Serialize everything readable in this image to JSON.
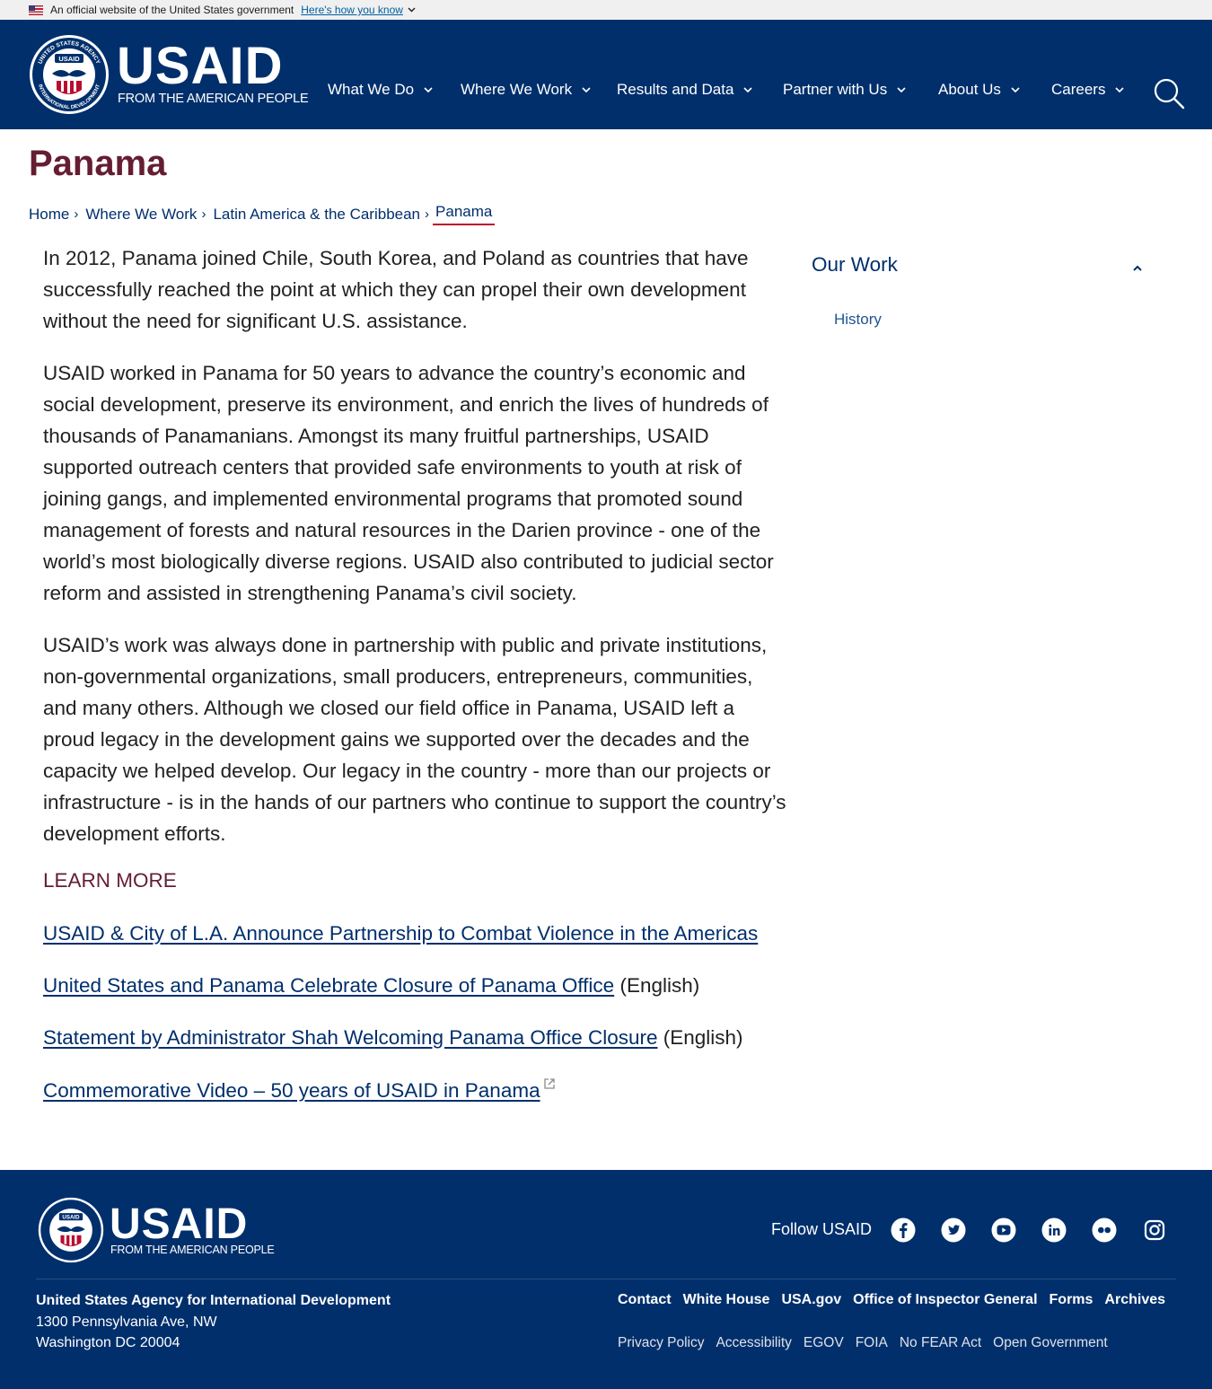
{
  "gov_banner": {
    "text": "An official website of the United States government",
    "link": "Here's how you know"
  },
  "header": {
    "logo_wordmark": "USAID",
    "logo_tagline": "FROM THE AMERICAN PEOPLE",
    "seal_top_text": "UNITED STATES AGENCY",
    "seal_bottom_text": "INTERNATIONAL DEVELOPMENT",
    "seal_center": "USAID",
    "nav": [
      "What We Do",
      "Where We Work",
      "Results and Data",
      "Partner with Us",
      "About Us",
      "Careers"
    ],
    "colors": {
      "navy": "#002f6c",
      "maroon": "#651d32",
      "red": "#ba0c2f"
    }
  },
  "page": {
    "title": "Panama",
    "breadcrumb": [
      "Home",
      "Where We Work",
      "Latin America & the Caribbean",
      "Panama"
    ]
  },
  "content": {
    "paragraphs": [
      "In 2012, Panama joined Chile, South Korea, and Poland as countries that have successfully reached the point at which they can propel their own development without the need for significant U.S. assistance.",
      "USAID worked in Panama for 50 years to advance the country’s economic and social development, preserve its environment, and enrich the lives of hundreds of thousands of Panamanians. Amongst its many fruitful partnerships, USAID supported outreach centers that provided safe environments to youth at risk of joining gangs, and implemented environmental programs that promoted sound management of forests and natural resources in the Darien province - one of the world’s most biologically diverse regions. USAID also contributed to judicial sector reform and assisted in strengthening Panama’s civil society.",
      "USAID’s work was always done in partnership with public and private institutions, non-governmental organizations, small producers, entrepreneurs, communities, and many others. Although we closed our field office in Panama, USAID left a proud legacy in the development gains we supported over the decades and the capacity we helped develop. Our legacy in the country - more than our projects or infrastructure - is in the hands of our partners who continue to support the country’s development efforts."
    ],
    "learn_more": "LEARN MORE",
    "links": [
      {
        "text": "USAID & City of L.A. Announce Partnership to Combat Violence in the Americas",
        "suffix": ""
      },
      {
        "text": "United States and Panama Celebrate Closure of Panama Office",
        "suffix": " (English)"
      },
      {
        "text": "Statement by Administrator Shah Welcoming Panama Office Closure",
        "suffix": " (English)"
      },
      {
        "text": "Commemorative Video – 50 years of USAID in Panama",
        "suffix": ""
      }
    ]
  },
  "sidebar": {
    "heading": "Our Work",
    "items": [
      "History"
    ]
  },
  "footer": {
    "follow": "Follow USAID",
    "social_icons": [
      "facebook-icon",
      "twitter-icon",
      "youtube-icon",
      "linkedin-icon",
      "flickr-icon",
      "instagram-icon"
    ],
    "org_name": "United States Agency for International Development",
    "address_line1": "1300 Pennsylvania Ave, NW",
    "address_line2": "Washington DC 20004",
    "links_primary": [
      "Contact",
      "White House",
      "USA.gov",
      "Office of Inspector General",
      "Forms",
      "Archives"
    ],
    "links_secondary": [
      "Privacy Policy",
      "Accessibility",
      "EGOV",
      "FOIA",
      "No FEAR Act",
      "Open Government"
    ]
  }
}
